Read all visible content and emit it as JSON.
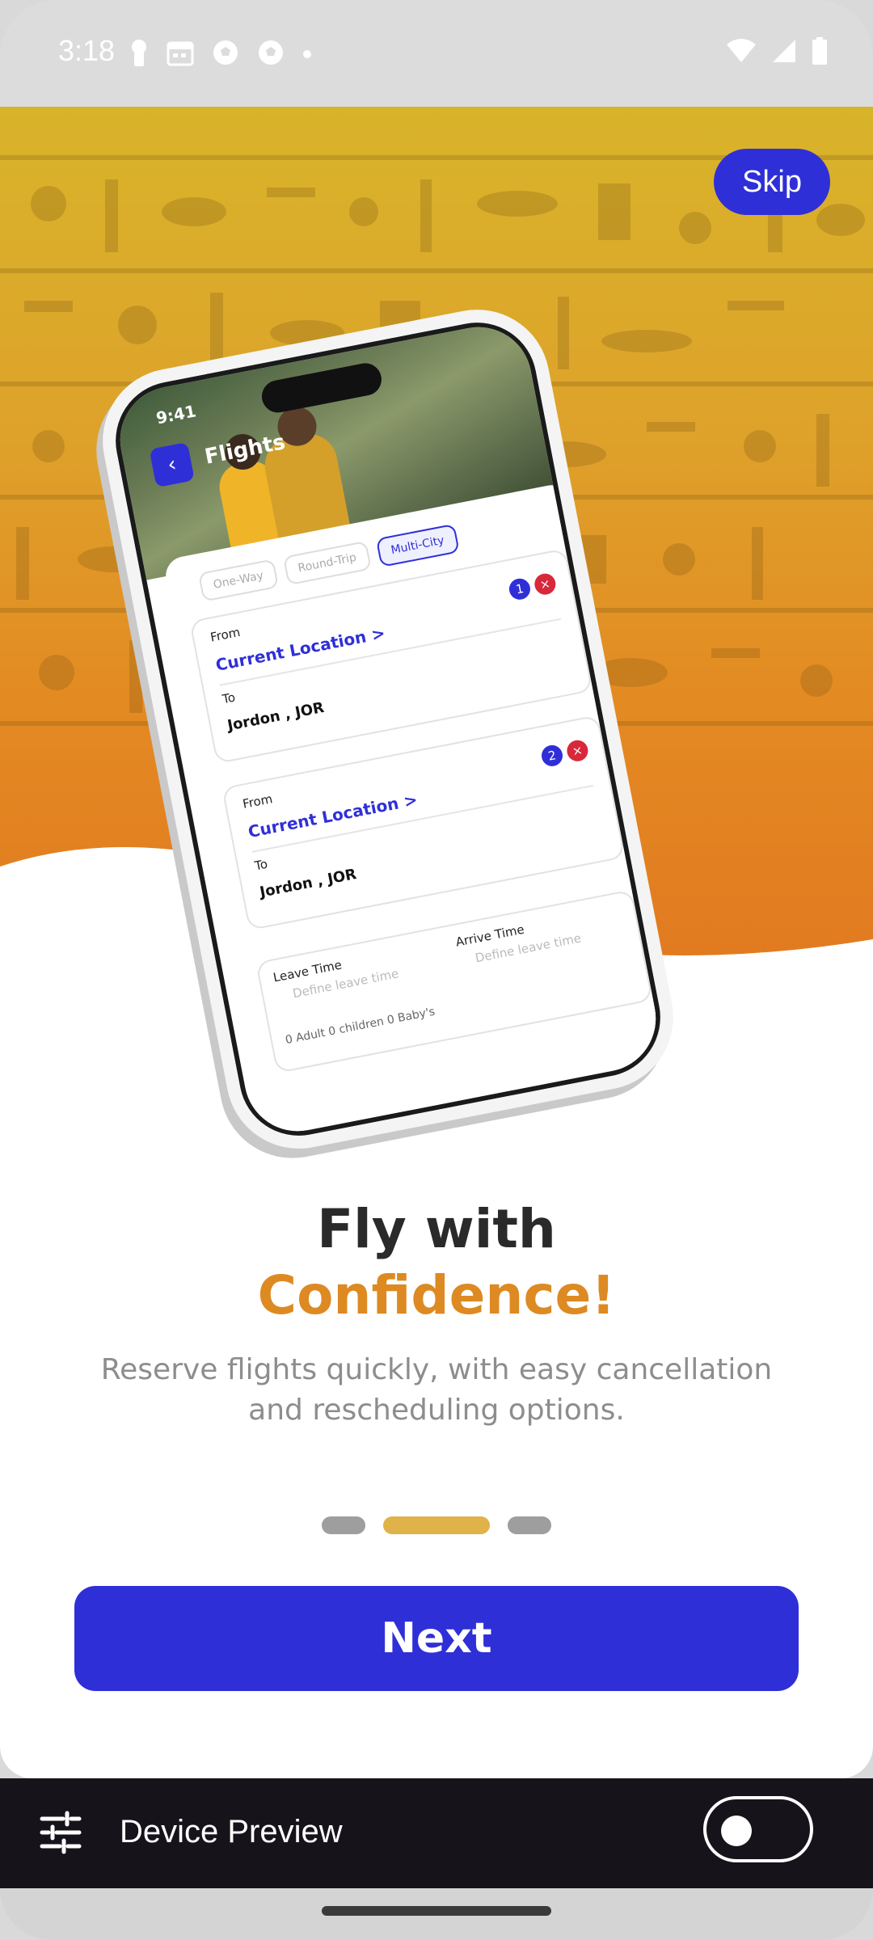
{
  "status_bar": {
    "time": "3:18"
  },
  "onboarding": {
    "skip_label": "Skip",
    "headline_line1": "Fly with",
    "headline_line2": "Confidence!",
    "subtitle": "Reserve flights quickly, with easy cancellation and rescheduling options.",
    "next_label": "Next",
    "page_indicator": {
      "total": 3,
      "active_index": 1
    },
    "colors": {
      "primary": "#2f2fd8",
      "accent": "#dd8a22",
      "dot_active": "#e0b24a",
      "dot_inactive": "#9e9e9e"
    }
  },
  "phone_mockup": {
    "time": "9:41",
    "title": "Flights",
    "trip_tabs": [
      "One-Way",
      "Round-Trip",
      "Multi-City"
    ],
    "active_tab": "Multi-City",
    "legs": [
      {
        "number": "1",
        "from_label": "From",
        "from_value": "Current Location >",
        "to_label": "To",
        "to_value": "Jordon , JOR"
      },
      {
        "number": "2",
        "from_label": "From",
        "from_value": "Current Location >",
        "to_label": "To",
        "to_value": "Jordon , JOR"
      }
    ],
    "leave_time_label": "Leave Time",
    "leave_time_placeholder": "Define leave time",
    "arrive_time_label": "Arrive Time",
    "arrive_time_placeholder": "Define leave time",
    "passengers": "0 Adult  0 children  0 Baby's"
  },
  "device_preview": {
    "label": "Device Preview",
    "toggle_on": false
  }
}
